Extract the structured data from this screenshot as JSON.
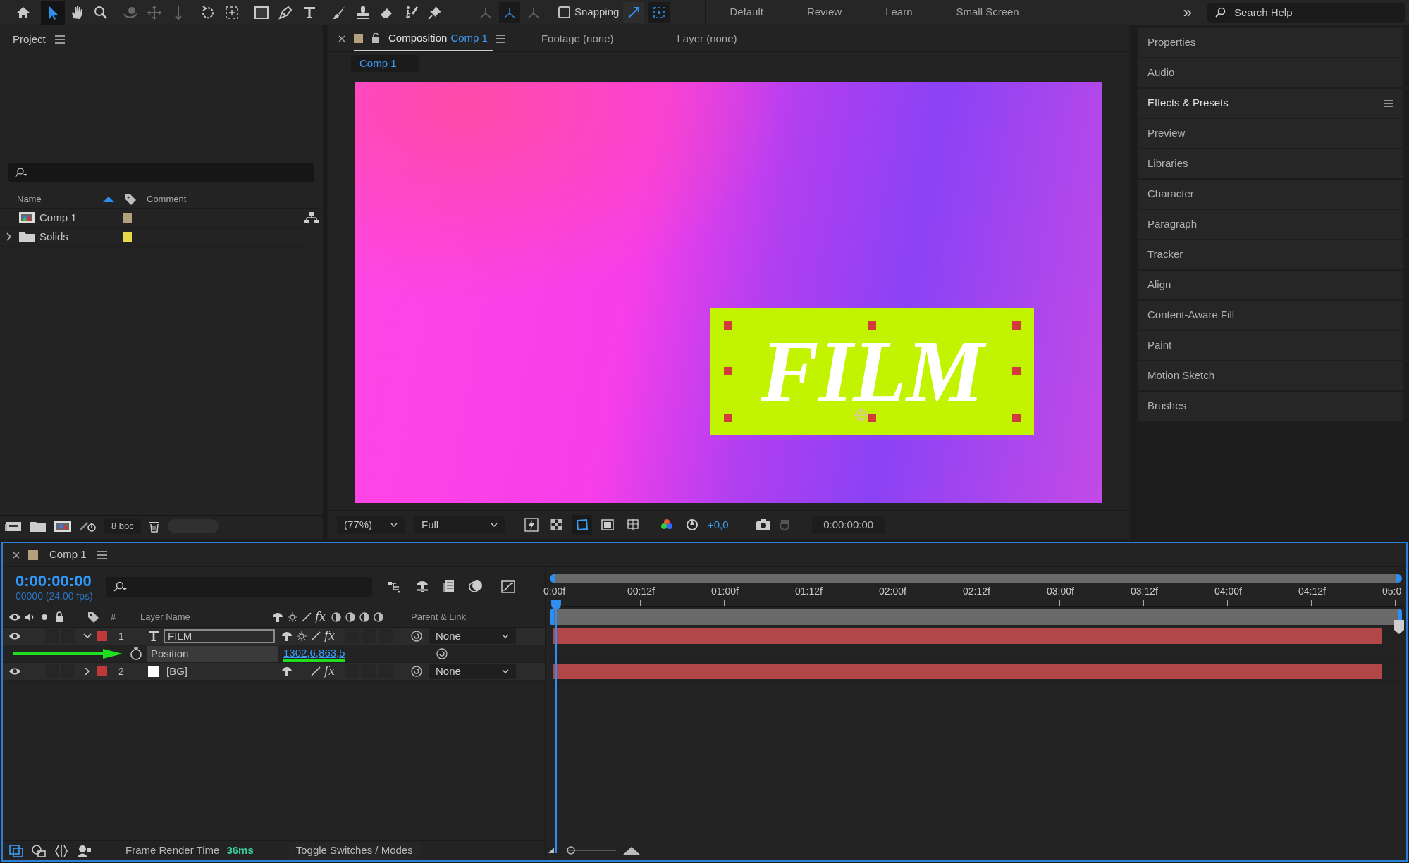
{
  "toolbar": {
    "tools": [
      {
        "kind": "home",
        "selected": false,
        "disabled": false
      },
      {
        "kind": "selection",
        "selected": true,
        "disabled": false
      },
      {
        "kind": "hand",
        "selected": false,
        "disabled": false
      },
      {
        "kind": "zoom",
        "selected": false,
        "disabled": false
      },
      {
        "kind": "orbit",
        "selected": false,
        "disabled": true
      },
      {
        "kind": "pan",
        "selected": false,
        "disabled": true
      },
      {
        "kind": "dolly",
        "selected": false,
        "disabled": true
      },
      {
        "kind": "rotate",
        "selected": false,
        "disabled": false
      },
      {
        "kind": "behind",
        "selected": false,
        "disabled": false
      },
      {
        "kind": "rectangle",
        "selected": false,
        "disabled": false
      },
      {
        "kind": "pen",
        "selected": false,
        "disabled": false
      },
      {
        "kind": "type",
        "selected": false,
        "disabled": false
      },
      {
        "kind": "brush",
        "selected": false,
        "disabled": false
      },
      {
        "kind": "stamp",
        "selected": false,
        "disabled": false
      },
      {
        "kind": "eraser",
        "selected": false,
        "disabled": false
      },
      {
        "kind": "roto",
        "selected": false,
        "disabled": false
      },
      {
        "kind": "pin",
        "selected": false,
        "disabled": false
      }
    ],
    "axis_modes": [
      {
        "selected": false
      },
      {
        "selected": true
      },
      {
        "selected": false
      }
    ],
    "snapping": {
      "label": "Snapping",
      "checked": false
    },
    "snap_options": [
      {
        "selected": false
      },
      {
        "selected": true
      }
    ],
    "workspaces": [
      "Default",
      "Review",
      "Learn",
      "Small Screen"
    ],
    "overflow": "»",
    "search": {
      "placeholder": "Search Help"
    }
  },
  "project": {
    "title": "Project",
    "columns": [
      "Name",
      "Comment"
    ],
    "items": [
      {
        "name": "Comp 1",
        "kind": "comp",
        "color": "#b5a07e",
        "expandable": false
      },
      {
        "name": "Solids",
        "kind": "folder",
        "color": "#e6d94a",
        "expandable": true
      }
    ],
    "bit_depth": "8 bpc"
  },
  "viewer": {
    "tabs": [
      {
        "label": "Composition",
        "suffix": "Comp 1",
        "selected": true
      },
      {
        "label": "Footage (none)",
        "selected": false
      },
      {
        "label": "Layer (none)",
        "selected": false
      }
    ],
    "subtab": "Comp 1",
    "canvas_text": "FILM",
    "zoom": "(77%)",
    "resolution": "Full",
    "exposure": "+0,0",
    "timecode": "0:00:00:00"
  },
  "panels": [
    {
      "label": "Properties",
      "menu": false
    },
    {
      "label": "Audio",
      "menu": false
    },
    {
      "label": "Effects & Presets",
      "menu": true
    },
    {
      "label": "Preview",
      "menu": false
    },
    {
      "label": "Libraries",
      "menu": false
    },
    {
      "label": "Character",
      "menu": false
    },
    {
      "label": "Paragraph",
      "menu": false
    },
    {
      "label": "Tracker",
      "menu": false
    },
    {
      "label": "Align",
      "menu": false
    },
    {
      "label": "Content-Aware Fill",
      "menu": false
    },
    {
      "label": "Paint",
      "menu": false
    },
    {
      "label": "Motion Sketch",
      "menu": false
    },
    {
      "label": "Brushes",
      "menu": false
    }
  ],
  "timeline": {
    "tab": "Comp 1",
    "timecode": "0:00:00:00",
    "fps": "00000 (24.00 fps)",
    "headers": {
      "number": "#",
      "layer_name": "Layer Name",
      "fx": "fx",
      "parent": "Parent & Link"
    },
    "layers": [
      {
        "number": "1",
        "name": "FILM",
        "kind": "text",
        "color": "#c0393b",
        "expanded": true,
        "fx": "fx",
        "parent": "None",
        "property": {
          "name": "Position",
          "value": "1302,6,863,5"
        }
      },
      {
        "number": "2",
        "name": "[BG]",
        "kind": "solid",
        "color": "#c0393b",
        "expanded": false,
        "fx": "fx",
        "parent": "None"
      }
    ],
    "ruler": [
      "0:00f",
      "00:12f",
      "01:00f",
      "01:12f",
      "02:00f",
      "02:12f",
      "03:00f",
      "03:12f",
      "04:00f",
      "04:12f",
      "05:0"
    ],
    "render_label": "Frame Render Time",
    "render_time": "36ms",
    "toggle": "Toggle Switches / Modes"
  }
}
